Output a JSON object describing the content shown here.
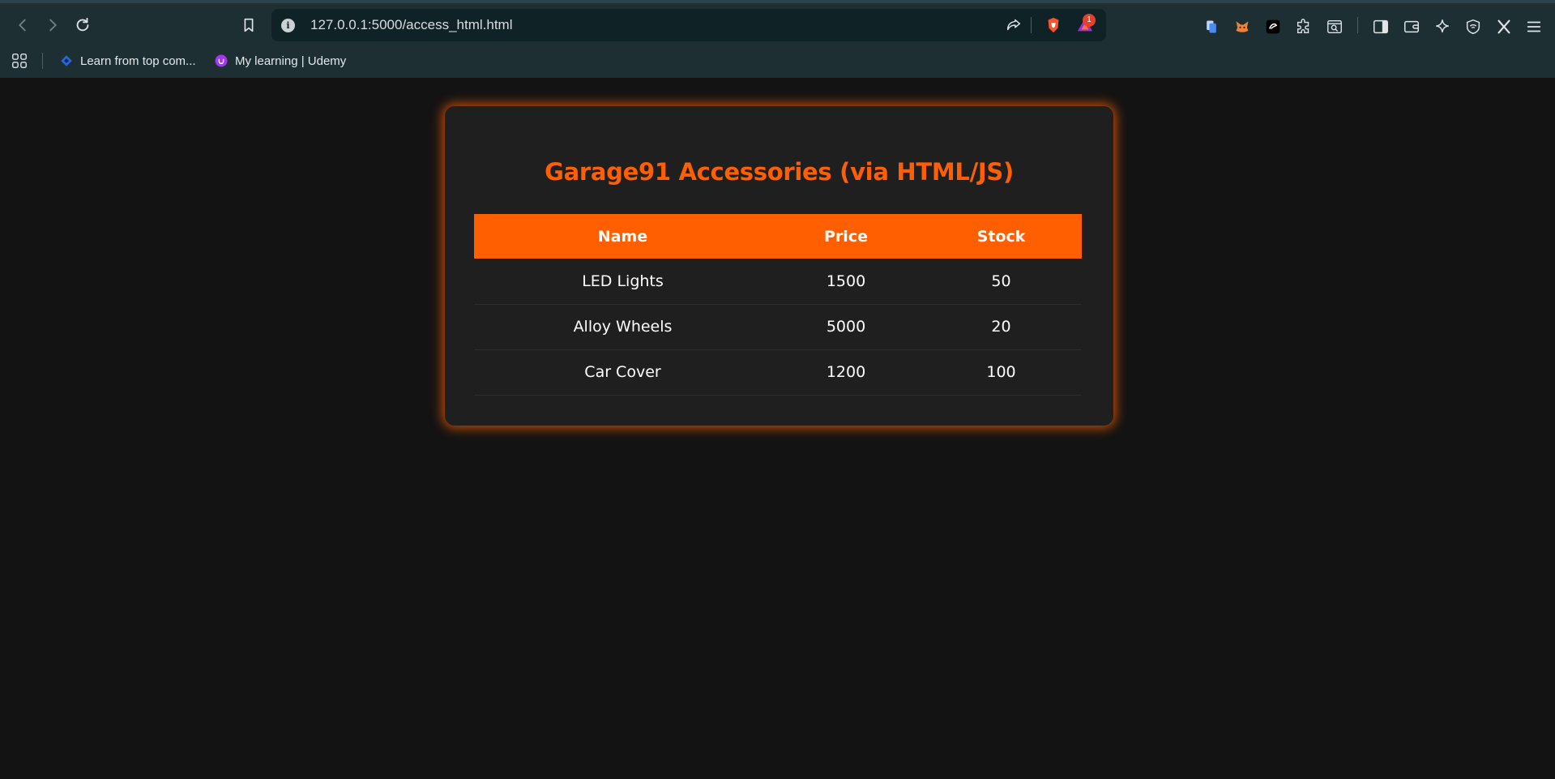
{
  "browser": {
    "url": "127.0.0.1:5000/access_html.html",
    "notification_count": "1",
    "bookmarks": [
      {
        "label": "Learn from top com..."
      },
      {
        "label": "My learning | Udemy"
      }
    ]
  },
  "page": {
    "title": "Garage91 Accessories (via HTML/JS)",
    "accent_color": "#ff5f00",
    "table": {
      "headers": [
        "Name",
        "Price",
        "Stock"
      ],
      "rows": [
        {
          "name": "LED Lights",
          "price": "1500",
          "stock": "50"
        },
        {
          "name": "Alloy Wheels",
          "price": "5000",
          "stock": "20"
        },
        {
          "name": "Car Cover",
          "price": "1200",
          "stock": "100"
        }
      ]
    }
  }
}
